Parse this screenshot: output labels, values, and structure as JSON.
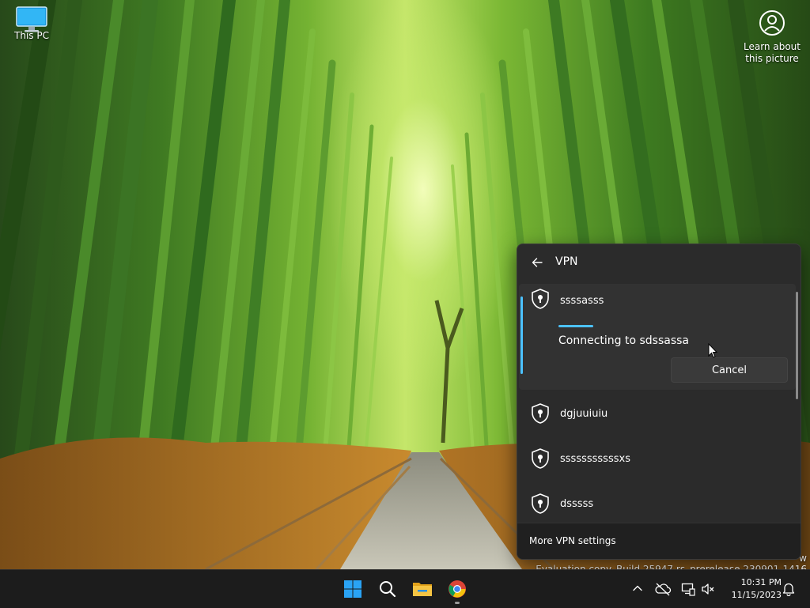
{
  "desktop": {
    "icons": [
      {
        "label": "This PC"
      },
      {
        "label": "Learn about this picture"
      }
    ],
    "watermark": {
      "line1": "w",
      "line2": "Evaluation copy. Build 25947.rs_prerelease.230901-1416"
    }
  },
  "vpn": {
    "title": "VPN",
    "connections": [
      {
        "name": "ssssasss",
        "status": "Connecting to sdssassa",
        "cancel_label": "Cancel",
        "progress": 0.25
      },
      {
        "name": "dgjuuiuiu"
      },
      {
        "name": "sssssssssssxs"
      },
      {
        "name": "dsssss"
      }
    ],
    "footer_link": "More VPN settings"
  },
  "taskbar": {
    "apps": [
      "start-icon",
      "search-icon",
      "file-explorer-icon",
      "chrome-icon"
    ],
    "tray": [
      "chevron-up-icon",
      "onedrive-icon",
      "network-icon",
      "volume-muted-icon"
    ],
    "clock": {
      "time": "10:31 PM",
      "date": "11/15/2023"
    },
    "notification_icon": "bell-icon"
  },
  "colors": {
    "accent": "#4cc2ff",
    "panel_bg": "#2b2b2b",
    "taskbar_bg": "#1c1c1c"
  }
}
